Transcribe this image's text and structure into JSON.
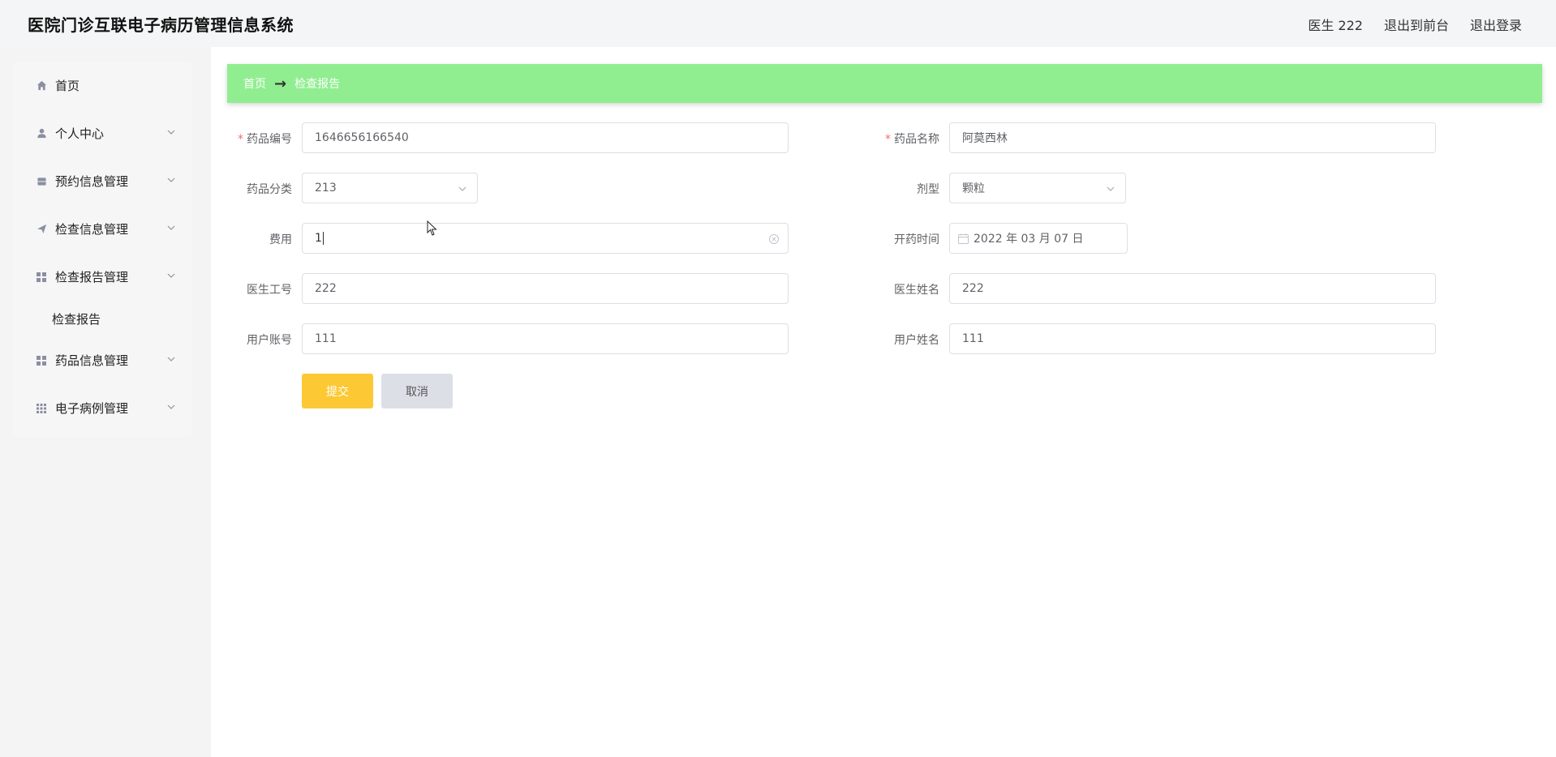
{
  "header": {
    "title": "医院门诊互联电子病历管理信息系统",
    "user": "医生 222",
    "exit_front": "退出到前台",
    "logout": "退出登录"
  },
  "sidebar": {
    "items": [
      {
        "label": "首页",
        "icon": "home-icon"
      },
      {
        "label": "个人中心",
        "icon": "user-icon"
      },
      {
        "label": "预约信息管理",
        "icon": "calendar-icon"
      },
      {
        "label": "检查信息管理",
        "icon": "send-icon"
      },
      {
        "label": "检查报告管理",
        "icon": "grid-icon"
      },
      {
        "label": "药品信息管理",
        "icon": "grid-icon"
      },
      {
        "label": "电子病例管理",
        "icon": "apps-icon"
      }
    ],
    "sub_items": [
      {
        "label": "检查报告"
      }
    ]
  },
  "breadcrumb": {
    "home": "首页",
    "arrow": "→",
    "current": "检查报告"
  },
  "form": {
    "drug_code": {
      "label": "药品编号",
      "value": "1646656166540"
    },
    "drug_name": {
      "label": "药品名称",
      "value": "阿莫西林"
    },
    "drug_category": {
      "label": "药品分类",
      "value": "213"
    },
    "dosage_form": {
      "label": "剂型",
      "value": "颗粒"
    },
    "cost": {
      "label": "费用",
      "value": "1"
    },
    "prescribe_time": {
      "label": "开药时间",
      "value": "2022 年 03 月 07 日"
    },
    "doctor_id": {
      "label": "医生工号",
      "value": "222"
    },
    "doctor_name": {
      "label": "医生姓名",
      "value": "222"
    },
    "user_account": {
      "label": "用户账号",
      "value": "111"
    },
    "user_name": {
      "label": "用户姓名",
      "value": "111"
    },
    "required_mark": "*"
  },
  "buttons": {
    "submit": "提交",
    "cancel": "取消"
  },
  "colors": {
    "breadcrumb_bg": "#90ee90",
    "submit_bg": "#fcc934",
    "cancel_bg": "#dcdfe6",
    "required": "#f56c6c"
  }
}
